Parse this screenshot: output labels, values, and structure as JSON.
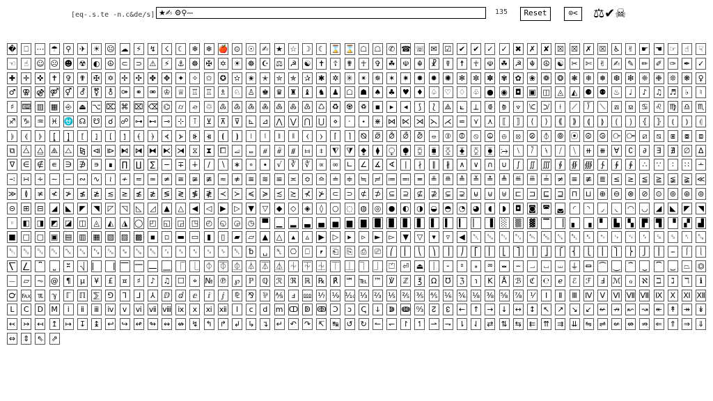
{
  "toolbar": {
    "prompt": "[eq-.s.te -n.c&de/s]",
    "input_value": "★✍ ⚙⚲⎓",
    "counter": "135",
    "reset_label": "Reset",
    "backspace_label": "⊙<",
    "logo_glyphs": "⚖✔☠"
  },
  "glyph_rows": [
    "�⎕⋯☂⚲✈☀☹☁⚡↯☇☾❄❄🍎⊙☉✍★☆☽☾⌛⌛☖☖✆☎☏✉☑✔✔✓✓✖✗✘☒☒✗☒♿",
    "✌☛☚☞☝☟☜☝☺☹☻☢◐☮⊂⊃⚠⚡⚓☸✠✡☀☸☪⚖☭☯✝☦✟☥✞☘☫☬☧☤☨☥☫",
    "☘☭☬☮☯✂✄✌✍✎✏✐✑✒✓✚✛✜✝✞✟✠✡✢✣✤✥✦✧✩✪✫✬✭✮✯✰✱✲",
    "✳✴✵✶✷✸✹✺✻✼✽✾✿❀❁❂❃❄❅❆❇❈❉❊❋♀♂⚢⚣⚤⚥⚦⚧⚨⚩⚭⚮♔♕♖",
    "♖♗♘♙♚♛♜♝♞♟☖☗♠♣♥♦♤♡♢♧●◉◘▣◫◬◭⚈⚉♨♩♪♫♬♭♮♯⌨▥▦",
    "⎆⏏⌥⌦⌘⌧⌫⌬⌭⌮♲♳♴♵♶♷♸♹♺♻♼♽▪▸◂⟆⟅⟁⟀⟂⟃⟄⟇⟈⟉⟊⟋⟌⟍⟎⟏",
    "♋♌♍♎♏♐♑♒♓⛎☊☋☌☍⊶⊷⊸⊹⊺⊻⊼⊽⊾⊿⋀⋁⋂⋃⋄⋅⋆⋇⋈⋉⋊⋋⋌⋍⋎⋏",
    "⟦⟧⟨⟩⟪⟫⟬⟭⟮⟯⦃⦄⦅⦆⦇⦈⦉⦊⦋⦌⦍⦎⦏⦐⦑⦒⦓⦔⦕⦖⦗⦘⧘⧙⧚⧛⧼⧽⌈⌉",
    "⦰⦱⦲⦳⦴⦵⦶⦷⦸⦹⦺⦻⦼⦽⦾⦿⧀⧁⧂⧃⧄⧅⧆⧇⧈⧉⧊⧋⧌⧍⧎⧏⧐⧑⧒⧓⧔⧕",
    "⧖⧗⧠⧡⧢⧣⧤⧥⧦⧧⧨⧩⧪⧫⧬⧭⧮⧯⧰⧱⧲⧳⧴⧵⧶⧷⧸⧹⧺⧻∀∁∂∃∄∅∆∇∈∉",
    "∊∋∌∍∎∏∐∑−∓∔∕∖∗∘∙√∛∜∝∞∟∠∡∢∣∤∥∦∧∨∩∪∫∬∭∮∯∰∱",
    "∲∳∴∵∶∷∸∹∺∻∼∽∾∿≀≁≂≃≄≅≆≇≈≉≊≋≌≍≎≏≐≑≒≓≔≕≖≗≘≙",
    "≚≛≜≝≞≟≠≡≢≣≤≥≦≧≨≩≪≫≬≭≮≯≰≱≲≳≴≵≶≷≸≹≺≻≼≽≾≿⊀⊁",
    "⊂⊃⊄⊅⊆⊇⊈⊉⊊⊋⊌⊍⊎⊏⊐⊑⊒⊓⊔⊕⊖⊗⊘⊙⊚⊛⊜⊝⊞⊟◢◣◤◥◸◹◺◿▲△",
    "◀◁▶▷▼▽◆◇◈◊○◌◍◎●◐◑◒◓◔◕◖◗◘◙◚◛◜◝◞◟◠◡◢◣◤◥◦◧◨",
    "◩◪◫◬◭◮◯◰◱◲◳◴◵◶◷▀▁▂▃▄▅▆▇█▉▊▋▌▍▎▏▐░▒▓▔▕▖▗▘",
    "▙▚▛▜▝▞▟■□▢▣▤▥▦▧▨▩▪▫▬▭▮▯▰▱▲△▴▵▶▷▸▹►▻▼▽▾▿◀",
    "␀␁␂␃␄␅␆␇␈␉␊␋␌␍␎␏␐␑␒␓␔␕␖␗␘␙␚␛␜␝␞␟␠␡␢␣␤⎔⎕⎖",
    "⎗⎘⎙⎚⎛⎜⎝⎞⎟⎠⎡⎢⎣⎤⎥⎦⎧⎨⎩⎪⎫⎬⎭⎮⎯⎰⎱⎲⎳⎴⎵⎶⎷⎸⎹⎺⎻⎼⎽⎾",
    "⎿⏀⏁⏂⏃⏄⏅⏆⏇⏈⏉⏊⏋⏌⏍⏎⏏⏐⏑⏒⏓⏔⏕⏖⏗⏘⏙⏚⏛⏜⏝⏞⏟⏠⏡⏢⏣⏤⏥⏦",
    "@¶µ¥£¤♯♪♫☐⌖№℗℘ℙℚℛℜℝ℞℟℠℡™℣ℤ℥Ω℧ℨ℩KÅℬℭ℮ℯℰℱℲℳ",
    "ℴℵℶℷℸℹ℺℻ℼℽℾℿ⅀⅁⅂⅃⅄ⅅⅆⅇⅈⅉ⅊⅋⅌⅍ⅎ⅏⅐⅑⅒⅓⅔⅕⅖⅗⅘⅙⅚⅛",
    "⅜⅝⅞⅟ⅠⅡⅢⅣⅤⅥⅦⅧⅨⅩⅪⅫⅬⅭⅮⅯⅰⅱⅲⅳⅴⅵⅶⅷⅸⅹⅺⅻⅼⅽⅾⅿↀↁↂↃ",
    "ↄↅↆↇↈ↉↊↋←↑→↓↔↕↖↗↘↙↚↛↜↝↞↟↠↡↢↣↤↥↦↧↨↩↪↫↬↭↮↯",
    "↰↱↲↳↴↵↶↷↸↹↺↻↼↽↾↿⇀⇁⇂⇃⇄⇅⇆⇇⇈⇉⇊⇋⇌⇍⇎⇏⇐⇑⇒⇓⇔⇕⇖⇗"
  ]
}
